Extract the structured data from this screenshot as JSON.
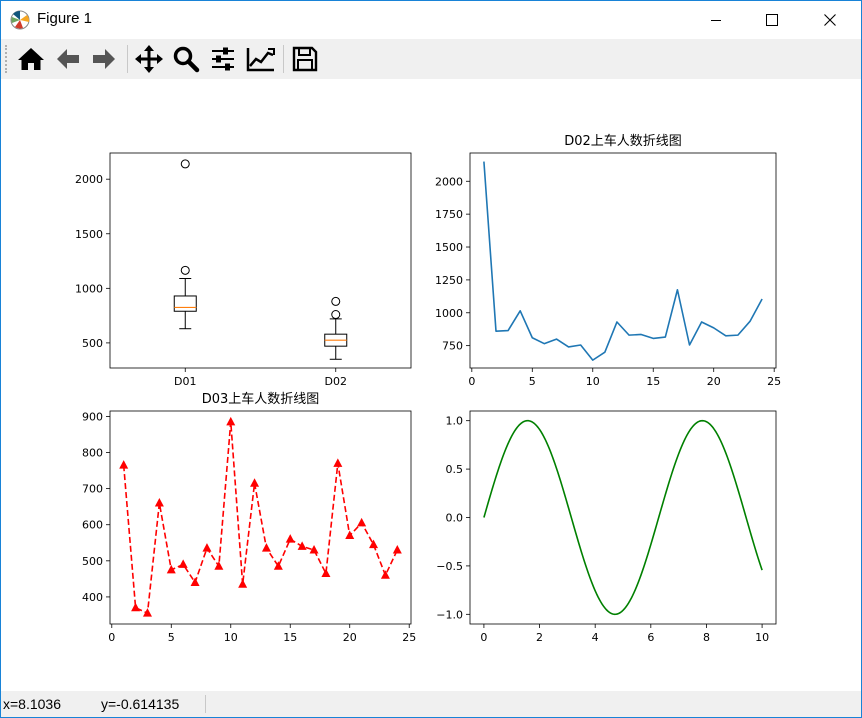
{
  "window": {
    "title": "Figure 1"
  },
  "icons": {
    "app": "matplotlib-logo-icon",
    "minimize": "minimize-icon",
    "maximize": "maximize-icon",
    "close": "close-icon"
  },
  "toolbar": {
    "buttons": [
      {
        "name": "home",
        "icon": "home-icon"
      },
      {
        "name": "back",
        "icon": "back-arrow-icon"
      },
      {
        "name": "forward",
        "icon": "forward-arrow-icon"
      },
      {
        "name": "pan",
        "icon": "move-icon"
      },
      {
        "name": "zoom",
        "icon": "magnifier-icon"
      },
      {
        "name": "configure-subplots",
        "icon": "sliders-icon"
      },
      {
        "name": "edit-axis",
        "icon": "line-chart-icon"
      },
      {
        "name": "save",
        "icon": "floppy-disk-icon"
      }
    ]
  },
  "status": {
    "x": "x=8.1036",
    "y": "y=-0.614135"
  },
  "chart_data": [
    {
      "type": "box",
      "title": "",
      "categories": [
        "D01",
        "D02"
      ],
      "boxes": [
        {
          "name": "D01",
          "whisker_low": 630,
          "q1": 790,
          "median": 825,
          "q3": 930,
          "whisker_high": 1090,
          "fliers": [
            1165,
            2140
          ]
        },
        {
          "name": "D02",
          "whisker_low": 350,
          "q1": 470,
          "median": 525,
          "q3": 580,
          "whisker_high": 720,
          "fliers": [
            760,
            880
          ]
        }
      ],
      "ylim": [
        270,
        2240
      ],
      "yticks": [
        500,
        1000,
        1500,
        2000
      ],
      "median_color": "#ff7f0e"
    },
    {
      "type": "line",
      "title": "D02上车人数折线图",
      "color": "#1f77b4",
      "x": [
        1,
        2,
        3,
        4,
        5,
        6,
        7,
        8,
        9,
        10,
        11,
        12,
        13,
        14,
        15,
        16,
        17,
        18,
        19,
        20,
        21,
        22,
        23,
        24
      ],
      "y": [
        2150,
        860,
        865,
        1015,
        810,
        765,
        800,
        740,
        755,
        640,
        700,
        930,
        830,
        835,
        805,
        815,
        1175,
        755,
        930,
        885,
        825,
        830,
        935,
        1105
      ],
      "xlim": [
        -0.15,
        25.15
      ],
      "ylim": [
        580,
        2215
      ],
      "xticks": [
        0,
        5,
        10,
        15,
        20,
        25
      ],
      "yticks": [
        750,
        1000,
        1250,
        1500,
        1750,
        2000
      ]
    },
    {
      "type": "line",
      "title": "D03上车人数折线图",
      "color": "#ff0000",
      "linestyle": "dashed",
      "marker": "triangle",
      "x": [
        1,
        2,
        3,
        4,
        5,
        6,
        7,
        8,
        9,
        10,
        11,
        12,
        13,
        14,
        15,
        16,
        17,
        18,
        19,
        20,
        21,
        22,
        23,
        24
      ],
      "y": [
        765,
        370,
        355,
        660,
        475,
        490,
        440,
        535,
        485,
        885,
        435,
        715,
        535,
        485,
        560,
        540,
        530,
        465,
        770,
        570,
        605,
        545,
        460,
        530
      ],
      "xlim": [
        -0.15,
        25.15
      ],
      "ylim": [
        325,
        915
      ],
      "xticks": [
        0,
        5,
        10,
        15,
        20,
        25
      ],
      "yticks": [
        400,
        500,
        600,
        700,
        800,
        900
      ]
    },
    {
      "type": "line",
      "title": "",
      "color": "#008000",
      "function": "sin(x)",
      "x_range": [
        0,
        10
      ],
      "xlim": [
        -0.5,
        10.5
      ],
      "ylim": [
        -1.1,
        1.1
      ],
      "xticks": [
        0,
        2,
        4,
        6,
        8,
        10
      ],
      "yticks": [
        -1.0,
        -0.5,
        0.0,
        0.5,
        1.0
      ],
      "ytick_labels": [
        "−1.0",
        "−0.5",
        "0.0",
        "0.5",
        "1.0"
      ]
    }
  ]
}
